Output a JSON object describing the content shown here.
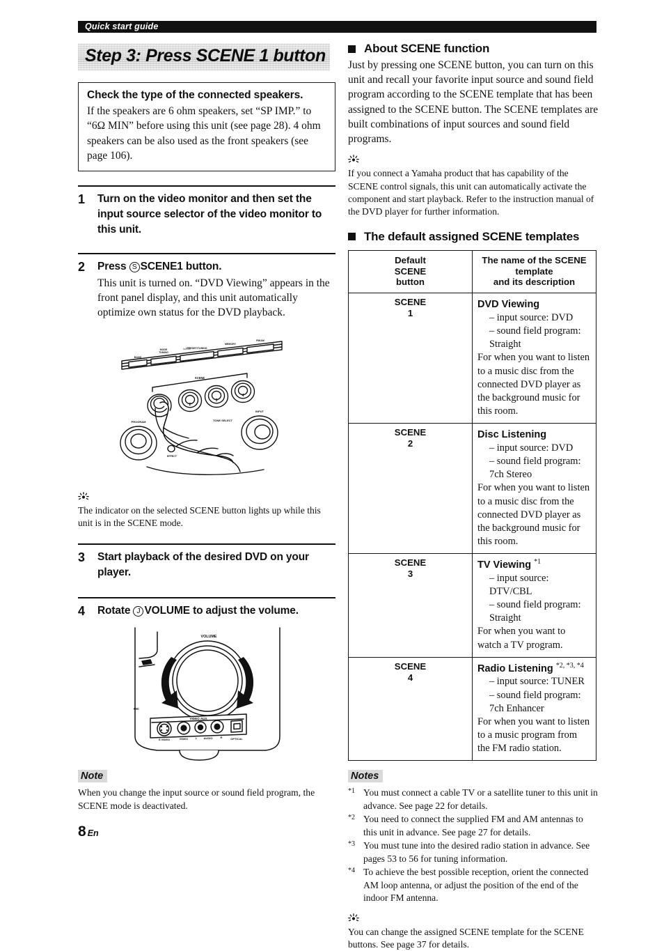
{
  "header": {
    "running_title": "Quick start guide"
  },
  "page_number": {
    "number": "8",
    "suffix": "En"
  },
  "left_column": {
    "step_banner": "Step 3: Press SCENE 1 button",
    "speaker_box": {
      "title": "Check the type of the connected speakers.",
      "body": "If the speakers are 6 ohm speakers, set “SP IMP.” to “6Ω MIN” before using this unit (see page 28). 4 ohm speakers can be also used as the front speakers (see page 106)."
    },
    "steps": [
      {
        "number": "1",
        "heading": "Turn on the video monitor and then set the input source selector of the video monitor to this unit.",
        "description": ""
      },
      {
        "number": "2",
        "heading_pre": "Press ",
        "heading_circle": "S",
        "heading_mid": "SCENE1",
        "heading_post": " button.",
        "description": "This unit is turned on. “DVD Viewing” appears in the front panel display, and this unit automatically optimize own status for the DVD playback."
      },
      {
        "number": "3",
        "heading": "Start playback of the desired DVD on your player.",
        "description": ""
      },
      {
        "number": "4",
        "heading_pre": "Rotate ",
        "heading_circle": "J",
        "heading_mid": "VOLUME",
        "heading_post": " to adjust the volume.",
        "description": ""
      }
    ],
    "tip_after_step2": {
      "glyph": "☀",
      "text": "The indicator on the selected SCENE button lights up while this unit is in the SCENE mode."
    },
    "note_bottom": {
      "tag": "Note",
      "text": "When you change the input source or sound field program, the SCENE mode is deactivated."
    },
    "illustration_1_labels": {
      "scene": "SCENE",
      "scene_2": "2",
      "scene_3": "3",
      "scene_4": "4",
      "program": "PROGRAM",
      "input": "INPUT",
      "tone_select": "TONE SELECT",
      "straight": "STRAIGHT",
      "effect": "EFFECT",
      "preset_tuning": "PRESET/TUNING",
      "memory": "MEMORY",
      "fm_am": "FM/AM",
      "band": "BAND",
      "tuning_mode": "TUNING MODE"
    },
    "illustration_2_labels": {
      "volume": "VOLUME",
      "video_aux": "VIDEO AUX",
      "s_video": "S VIDEO",
      "video": "VIDEO",
      "audio_l": "L",
      "audio": "AUDIO",
      "audio_r": "R",
      "optical": "OPTICAL",
      "mic": "MIC"
    }
  },
  "right_column": {
    "about": {
      "heading": "About SCENE function",
      "body": "Just by pressing one SCENE button, you can turn on this unit and recall your favorite input source and sound field program according to the SCENE template that has been assigned to the SCENE button. The SCENE templates are built combinations of input sources and sound field programs.",
      "tip_glyph": "☀",
      "tip_text": "If you connect a Yamaha product that has capability of the SCENE control signals, this unit can automatically activate the component and start playback. Refer to the instruction manual of the DVD player for further information."
    },
    "templates": {
      "heading": "The default assigned SCENE templates",
      "columns": [
        "Default SCENE button",
        "The name of the SCENE template and its description"
      ],
      "col1_lines": [
        "Default",
        "SCENE",
        "button"
      ],
      "col2_lines": [
        "The name of the SCENE template",
        "and its description"
      ],
      "rows": [
        {
          "button_label": "SCENE",
          "button_number": "1",
          "name": "DVD Viewing",
          "footnote_marks": "",
          "bullets": [
            "– input source: DVD",
            "– sound field program: Straight"
          ],
          "description": "For when you want to listen to a music disc from the connected DVD player as the background music for this room."
        },
        {
          "button_label": "SCENE",
          "button_number": "2",
          "name": "Disc Listening",
          "footnote_marks": "",
          "bullets": [
            "– input source: DVD",
            "– sound field program: 7ch Stereo"
          ],
          "description": "For when you want to listen to a music disc from the connected DVD player as the background music for this room."
        },
        {
          "button_label": "SCENE",
          "button_number": "3",
          "name": "TV Viewing",
          "footnote_marks": "*1",
          "bullets": [
            "– input source: DTV/CBL",
            "– sound field program: Straight"
          ],
          "description": "For when you want to watch a TV program."
        },
        {
          "button_label": "SCENE",
          "button_number": "4",
          "name": "Radio Listening",
          "footnote_marks": "*2, *3, *4",
          "bullets": [
            "– input source: TUNER",
            "– sound field program: 7ch Enhancer"
          ],
          "description": "For when you want to listen to a music program from the FM radio station."
        }
      ]
    },
    "notes": {
      "tag": "Notes",
      "items": [
        {
          "mark": "*1",
          "text": "You must connect a cable TV or a satellite tuner to this unit in advance. See page 22 for details."
        },
        {
          "mark": "*2",
          "text": "You need to connect the supplied FM and AM antennas to this unit in advance. See page 27 for details."
        },
        {
          "mark": "*3",
          "text": "You must tune into the desired radio station in advance. See pages 53 to 56 for tuning information."
        },
        {
          "mark": "*4",
          "text": "To achieve the best possible reception, orient the connected AM loop antenna, or adjust the position of the end of the indoor FM antenna."
        }
      ],
      "tip_glyph": "☀",
      "tip_text": "You can change the assigned SCENE template for the SCENE buttons. See page 37 for details."
    }
  },
  "colors": {
    "ink": "#111111",
    "banner_gray": "#dadada",
    "tag_gray": "#d9d9d9",
    "paper": "#ffffff"
  }
}
